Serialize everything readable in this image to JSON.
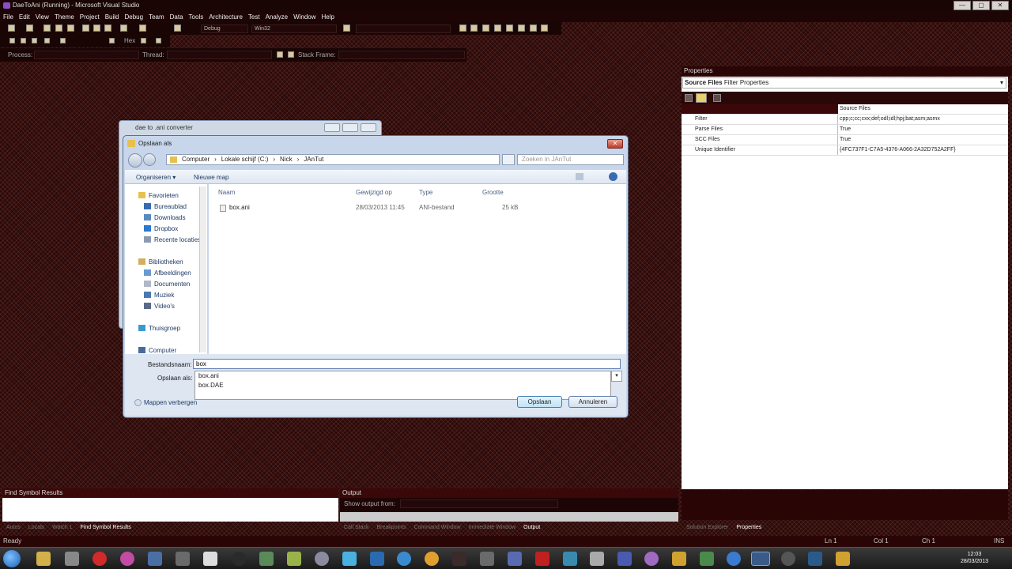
{
  "window": {
    "title": "DaeToAni (Running) - Microsoft Visual Studio",
    "controls": [
      "—",
      "▢",
      "✕"
    ]
  },
  "menu": [
    "File",
    "Edit",
    "View",
    "Theme",
    "Project",
    "Build",
    "Debug",
    "Team",
    "Data",
    "Tools",
    "Architecture",
    "Test",
    "Analyze",
    "Window",
    "Help"
  ],
  "toolbar": {
    "config": "Debug",
    "platform": "Win32",
    "hex_label": "Hex"
  },
  "debug_location": {
    "process_label": "Process:",
    "thread_label": "Thread:",
    "stack_label": "Stack Frame:"
  },
  "properties": {
    "panel_title": "Properties",
    "selector_bold": "Source Files",
    "selector_rest": "Filter Properties",
    "category": "Source Files",
    "rows": [
      {
        "key": "Filter",
        "value": "cpp;c;cc;cxx;def;odl;idl;hpj;bat;asm;asmx"
      },
      {
        "key": "Parse Files",
        "value": "True"
      },
      {
        "key": "SCC Files",
        "value": "True"
      },
      {
        "key": "Unique Identifier",
        "value": "{4FC737F1-C7A5-4376-A066-2A32D752A2FF}"
      }
    ]
  },
  "bottom": {
    "find_symbol_title": "Find Symbol Results",
    "output_title": "Output",
    "show_output_label": "Show output from:",
    "left_tabs": [
      "Autos",
      "Locals",
      "Watch 1",
      "Find Symbol Results"
    ],
    "middle_tabs": [
      "Call Stack",
      "Breakpoints",
      "Command Window",
      "Immediate Window",
      "Output"
    ],
    "right_tabs": [
      "Solution Explorer",
      "Properties"
    ]
  },
  "statusbar": {
    "left": "Ready",
    "ln": "Ln 1",
    "col": "Col 1",
    "ch": "Ch 1",
    "ins": "INS"
  },
  "clock": {
    "time": "12:03",
    "date": "28/03/2013"
  },
  "bg_window": {
    "title": "dae to .ani converter"
  },
  "dialog": {
    "title": "Opslaan als",
    "path": [
      "Computer",
      "Lokale schijf (C:)",
      "Nick",
      "JAnTut"
    ],
    "search_placeholder": "Zoeken in JAnTut",
    "organize": "Organiseren ▾",
    "new_folder": "Nieuwe map",
    "nav": {
      "favorites": "Favorieten",
      "desktop": "Bureaublad",
      "downloads": "Downloads",
      "dropbox": "Dropbox",
      "recent": "Recente locaties",
      "libraries": "Bibliotheken",
      "pictures": "Afbeeldingen",
      "documents": "Documenten",
      "music": "Muziek",
      "videos": "Video's",
      "homegroup": "Thuisgroep",
      "computer": "Computer"
    },
    "columns": {
      "name": "Naam",
      "modified": "Gewijzigd op",
      "type": "Type",
      "size": "Grootte"
    },
    "files": [
      {
        "name": "box.ani",
        "modified": "28/03/2013 11:45",
        "type": "ANI-bestand",
        "size": "25 kB"
      }
    ],
    "filename_label": "Bestandsnaam:",
    "filename_value": "box",
    "saveas_label": "Opslaan als:",
    "autocomplete": [
      "box.ani",
      "box.DAE"
    ],
    "hide_folders": "Mappen verbergen",
    "save": "Opslaan",
    "cancel": "Annuleren"
  }
}
